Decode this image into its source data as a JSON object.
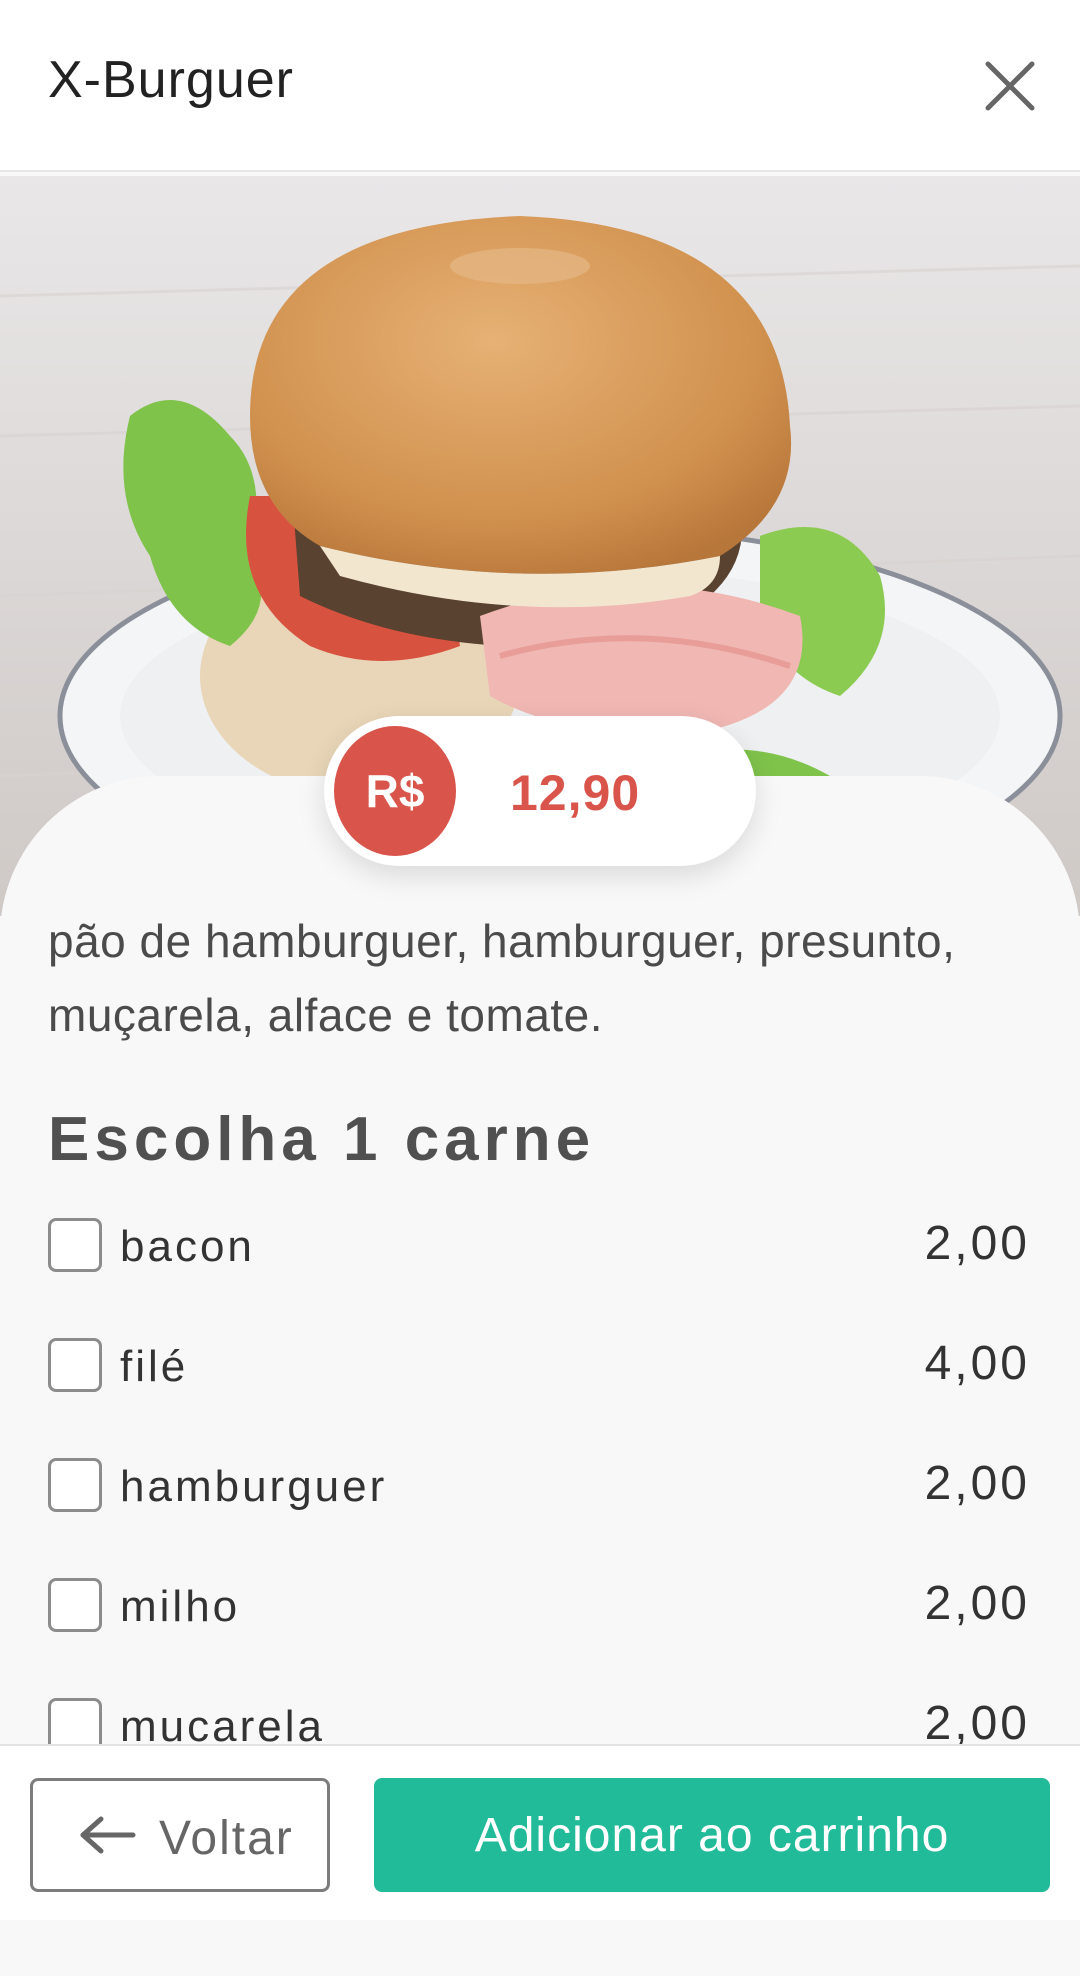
{
  "header": {
    "title": "X-Burguer",
    "close_icon": "close-icon"
  },
  "product": {
    "image_icon": "burger-photo",
    "currency": "R$",
    "price": "12,90",
    "description": "pão de hamburguer, hamburguer, presunto, muçarela, alface e tomate."
  },
  "options_section": {
    "title": "Escolha 1 carne",
    "items": [
      {
        "name": "bacon",
        "price": "2,00",
        "checked": false
      },
      {
        "name": "filé",
        "price": "4,00",
        "checked": false
      },
      {
        "name": "hamburguer",
        "price": "2,00",
        "checked": false
      },
      {
        "name": "milho",
        "price": "2,00",
        "checked": false
      },
      {
        "name": "mucarela",
        "price": "2,00",
        "checked": false
      }
    ]
  },
  "footer": {
    "back_label": "Voltar",
    "back_icon": "arrow-left-icon",
    "add_label": "Adicionar ao carrinho"
  },
  "colors": {
    "accent_red": "#d9544a",
    "accent_green": "#22bb99"
  }
}
